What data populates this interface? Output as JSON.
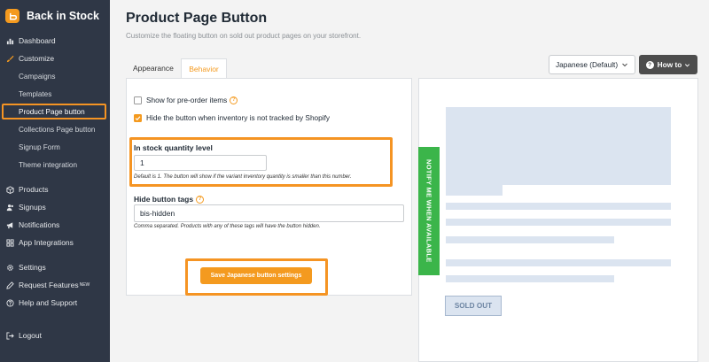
{
  "app": {
    "name": "Back in Stock",
    "logo_icon": "back-in-stock-logo-icon",
    "accent_color": "#f49a1f"
  },
  "sidebar": {
    "items": [
      {
        "label": "Dashboard",
        "icon": "chart-icon"
      },
      {
        "label": "Customize",
        "icon": "brush-icon"
      },
      {
        "label": "Campaigns"
      },
      {
        "label": "Templates"
      },
      {
        "label": "Product Page button",
        "active": true
      },
      {
        "label": "Collections Page button"
      },
      {
        "label": "Signup Form"
      },
      {
        "label": "Theme integration"
      },
      {
        "label": "Products",
        "icon": "box-icon"
      },
      {
        "label": "Signups",
        "icon": "users-icon"
      },
      {
        "label": "Notifications",
        "icon": "megaphone-icon"
      },
      {
        "label": "App Integrations",
        "icon": "grid-icon"
      },
      {
        "label": "Settings",
        "icon": "gear-icon"
      },
      {
        "label": "Request Features",
        "badge": "NEW",
        "icon": "pencil-icon"
      },
      {
        "label": "Help and Support",
        "icon": "question-icon"
      },
      {
        "label": "Logout",
        "icon": "logout-icon"
      }
    ]
  },
  "header": {
    "title": "Product Page Button",
    "subtitle": "Customize the floating button on sold out product pages on your storefront."
  },
  "tabs": [
    {
      "label": "Appearance",
      "active": false
    },
    {
      "label": "Behavior",
      "active": true
    }
  ],
  "behavior": {
    "preorder": {
      "label": "Show for pre-order items",
      "checked": false
    },
    "hide_untracked": {
      "label": "Hide the button when inventory is not tracked by Shopify",
      "checked": true
    },
    "quantity": {
      "label": "In stock quantity level",
      "value": "1",
      "help": "Default is 1. The button will show if the variant inventory quantity is smaller than this number."
    },
    "hide_tags": {
      "label": "Hide button tags",
      "value": "bis-hidden",
      "help": "Comma separated. Products with any of these tags will have the button hidden."
    },
    "save_label": "Save Japanese button settings"
  },
  "controls": {
    "language": "Japanese (Default)",
    "howto": "How to"
  },
  "preview": {
    "notify_label": "NOTIFY ME WHEN AVAILABLE",
    "notify_color": "#3bb54a",
    "sold_out_label": "SOLD OUT"
  }
}
